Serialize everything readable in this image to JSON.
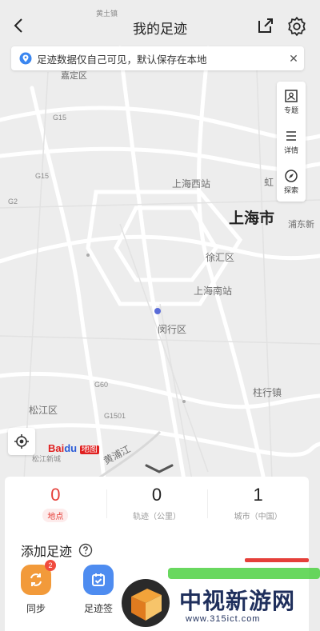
{
  "header": {
    "title": "我的足迹"
  },
  "notice": {
    "text": "足迹数据仅自己可见，默认保存在本地"
  },
  "side_toolbar": [
    {
      "label": "专题",
      "icon": "topic-icon"
    },
    {
      "label": "详情",
      "icon": "list-icon"
    },
    {
      "label": "探索",
      "icon": "explore-icon"
    }
  ],
  "map": {
    "labels": {
      "top_town": "黄土镇",
      "jiading": "嘉定区",
      "hw_g15a": "G15",
      "hw_g15b": "G15",
      "hw_g2": "G2",
      "west_station": "上海西站",
      "hongqiao": "虹",
      "shanghai": "上海市",
      "shanghai_east": "浦东新",
      "xuhui": "徐汇区",
      "south_station": "上海南站",
      "minhang": "闵行区",
      "songjiang": "松江区",
      "tinglin": "松江新城",
      "huangpu": "黄浦江",
      "hw_g60": "G60",
      "hw_g1501": "G1501",
      "zhuqiao": "柱行镇"
    },
    "logo": {
      "brand": "Bai",
      "paw": "du",
      "sub": "地图"
    }
  },
  "stats": [
    {
      "value": "0",
      "label": "地点",
      "active": true
    },
    {
      "value": "0",
      "label": "轨迹（公里）",
      "active": false
    },
    {
      "value": "1",
      "label": "城市（中国）",
      "active": false
    }
  ],
  "add_section": {
    "title": "添加足迹"
  },
  "actions": [
    {
      "label": "同步",
      "badge": "2",
      "color": "#f29a3a"
    },
    {
      "label": "足迹签",
      "badge": "",
      "color": "#4e8cf0"
    }
  ],
  "watermark": {
    "name": "中视新游网",
    "url": "www.315ict.com"
  },
  "colors": {
    "accent": "#e5403a",
    "brand_blue": "#2b5bd7"
  }
}
